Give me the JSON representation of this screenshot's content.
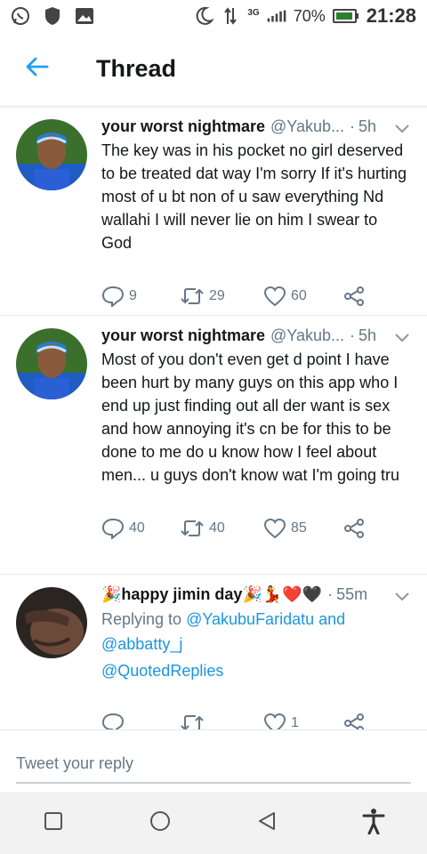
{
  "status_bar": {
    "network": "3G",
    "battery": "70%",
    "time": "21:28"
  },
  "header": {
    "title": "Thread"
  },
  "tweets": [
    {
      "name": "your worst nightmare",
      "handle": "@Yakub...",
      "dot": "·",
      "time": "5h",
      "text": "The key was in his pocket no girl deserved to be treated dat way I'm sorry If it's hurting most of u bt non of u saw everything Nd wallahi I will never lie on him I swear to God",
      "replies": "9",
      "retweets": "29",
      "likes": "60"
    },
    {
      "name": "your worst nightmare",
      "handle": "@Yakub...",
      "dot": "·",
      "time": "5h",
      "text": "Most of you don't even get d point I have been hurt by many guys on this app who I end up just finding out all der want is sex and how annoying it's cn be for this to be done to me do u know how I feel about men... u guys don't know wat I'm going tru",
      "replies": "40",
      "retweets": "40",
      "likes": "85"
    },
    {
      "name": "🎉happy jimin day🎉💃❤️🖤",
      "dot": "·",
      "time": "55m",
      "replying_prefix": "Replying to",
      "reply_user_1": "@YakubuFaridatu",
      "reply_and": "and",
      "reply_user_2": "@abbatty_j",
      "quoted_replies": "@QuotedReplies",
      "replies": "",
      "retweets": "",
      "likes": "1"
    }
  ],
  "reply_bar": {
    "placeholder": "Tweet your reply"
  },
  "icons": {
    "back": "arrow-left-icon",
    "reply": "reply-icon",
    "retweet": "retweet-icon",
    "like": "heart-icon",
    "share": "share-icon",
    "more": "chevron-down-icon"
  },
  "colors": {
    "accent": "#1da1f2",
    "text": "#14171a",
    "muted": "#657786"
  }
}
